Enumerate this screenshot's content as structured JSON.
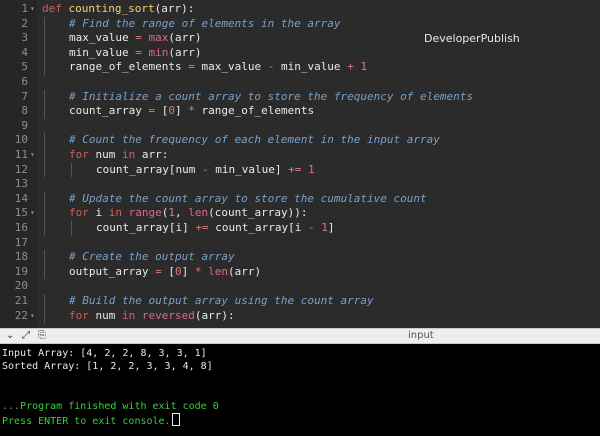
{
  "editor": {
    "watermark": "DeveloperPublish",
    "lines": [
      {
        "n": "1",
        "fold": true,
        "indent": 0,
        "tokens": [
          [
            "kw",
            "def "
          ],
          [
            "fn",
            "counting_sort"
          ],
          [
            "id",
            "(arr):"
          ]
        ]
      },
      {
        "n": "2",
        "indent": 1,
        "tokens": [
          [
            "cm",
            "# Find the range of elements in the array"
          ]
        ]
      },
      {
        "n": "3",
        "indent": 1,
        "tokens": [
          [
            "id",
            "max_value "
          ],
          [
            "op",
            "= "
          ],
          [
            "bi",
            "max"
          ],
          [
            "id",
            "(arr)"
          ]
        ]
      },
      {
        "n": "4",
        "indent": 1,
        "tokens": [
          [
            "id",
            "min_value "
          ],
          [
            "op",
            "= "
          ],
          [
            "bi",
            "min"
          ],
          [
            "id",
            "(arr)"
          ]
        ]
      },
      {
        "n": "5",
        "indent": 1,
        "tokens": [
          [
            "id",
            "range_of_elements "
          ],
          [
            "op",
            "= "
          ],
          [
            "id",
            "max_value "
          ],
          [
            "op",
            "- "
          ],
          [
            "id",
            "min_value "
          ],
          [
            "op",
            "+ "
          ],
          [
            "num",
            "1"
          ]
        ]
      },
      {
        "n": "6",
        "indent": 0,
        "tokens": []
      },
      {
        "n": "7",
        "indent": 1,
        "tokens": [
          [
            "cm",
            "# Initialize a count array to store the frequency of elements"
          ]
        ]
      },
      {
        "n": "8",
        "indent": 1,
        "tokens": [
          [
            "id",
            "count_array "
          ],
          [
            "op",
            "= "
          ],
          [
            "id",
            "["
          ],
          [
            "num",
            "0"
          ],
          [
            "id",
            "] "
          ],
          [
            "op",
            "* "
          ],
          [
            "id",
            "range_of_elements"
          ]
        ]
      },
      {
        "n": "9",
        "indent": 0,
        "tokens": []
      },
      {
        "n": "10",
        "indent": 1,
        "tokens": [
          [
            "cm",
            "# Count the frequency of each element in the input array"
          ]
        ]
      },
      {
        "n": "11",
        "fold": true,
        "indent": 1,
        "tokens": [
          [
            "kw",
            "for "
          ],
          [
            "id",
            "num "
          ],
          [
            "kw",
            "in "
          ],
          [
            "id",
            "arr:"
          ]
        ]
      },
      {
        "n": "12",
        "indent": 2,
        "tokens": [
          [
            "id",
            "count_array[num "
          ],
          [
            "op",
            "- "
          ],
          [
            "id",
            "min_value] "
          ],
          [
            "op",
            "+= "
          ],
          [
            "num",
            "1"
          ]
        ]
      },
      {
        "n": "13",
        "indent": 0,
        "tokens": []
      },
      {
        "n": "14",
        "indent": 1,
        "tokens": [
          [
            "cm",
            "# Update the count array to store the cumulative count"
          ]
        ]
      },
      {
        "n": "15",
        "fold": true,
        "indent": 1,
        "tokens": [
          [
            "kw",
            "for "
          ],
          [
            "id",
            "i "
          ],
          [
            "kw",
            "in "
          ],
          [
            "bi",
            "range"
          ],
          [
            "id",
            "("
          ],
          [
            "num",
            "1"
          ],
          [
            "id",
            ", "
          ],
          [
            "bi",
            "len"
          ],
          [
            "id",
            "(count_array)):"
          ]
        ]
      },
      {
        "n": "16",
        "indent": 2,
        "tokens": [
          [
            "id",
            "count_array[i] "
          ],
          [
            "op",
            "+= "
          ],
          [
            "id",
            "count_array[i "
          ],
          [
            "op",
            "- "
          ],
          [
            "num",
            "1"
          ],
          [
            "id",
            "]"
          ]
        ]
      },
      {
        "n": "17",
        "indent": 0,
        "tokens": []
      },
      {
        "n": "18",
        "indent": 1,
        "tokens": [
          [
            "cm",
            "# Create the output array"
          ]
        ]
      },
      {
        "n": "19",
        "indent": 1,
        "tokens": [
          [
            "id",
            "output_array "
          ],
          [
            "op",
            "= "
          ],
          [
            "id",
            "["
          ],
          [
            "num",
            "0"
          ],
          [
            "id",
            "] "
          ],
          [
            "op",
            "* "
          ],
          [
            "bi",
            "len"
          ],
          [
            "id",
            "(arr)"
          ]
        ]
      },
      {
        "n": "20",
        "indent": 0,
        "tokens": []
      },
      {
        "n": "21",
        "indent": 1,
        "tokens": [
          [
            "cm",
            "# Build the output array using the count array"
          ]
        ]
      },
      {
        "n": "22",
        "fold": true,
        "indent": 1,
        "tokens": [
          [
            "kw",
            "for "
          ],
          [
            "id",
            "num "
          ],
          [
            "kw",
            "in "
          ],
          [
            "bi",
            "reversed"
          ],
          [
            "id",
            "(arr):"
          ]
        ]
      }
    ]
  },
  "panel": {
    "title": "input",
    "icons": [
      {
        "name": "collapse-chevron-icon",
        "glyph": "⌄"
      },
      {
        "name": "expand-arrows-icon",
        "glyph": "⤢"
      },
      {
        "name": "copy-icon",
        "glyph": "⎘"
      }
    ]
  },
  "console": {
    "lines": [
      {
        "text": "Input Array: [4, 2, 2, 8, 3, 3, 1]",
        "color": "white"
      },
      {
        "text": "Sorted Array: [1, 2, 2, 3, 3, 4, 8]",
        "color": "white"
      },
      {
        "text": "",
        "color": "white"
      },
      {
        "text": "",
        "color": "white"
      },
      {
        "text": "...Program finished with exit code 0",
        "color": "green"
      },
      {
        "text": "Press ENTER to exit console.",
        "color": "green",
        "cursor": true
      }
    ]
  }
}
